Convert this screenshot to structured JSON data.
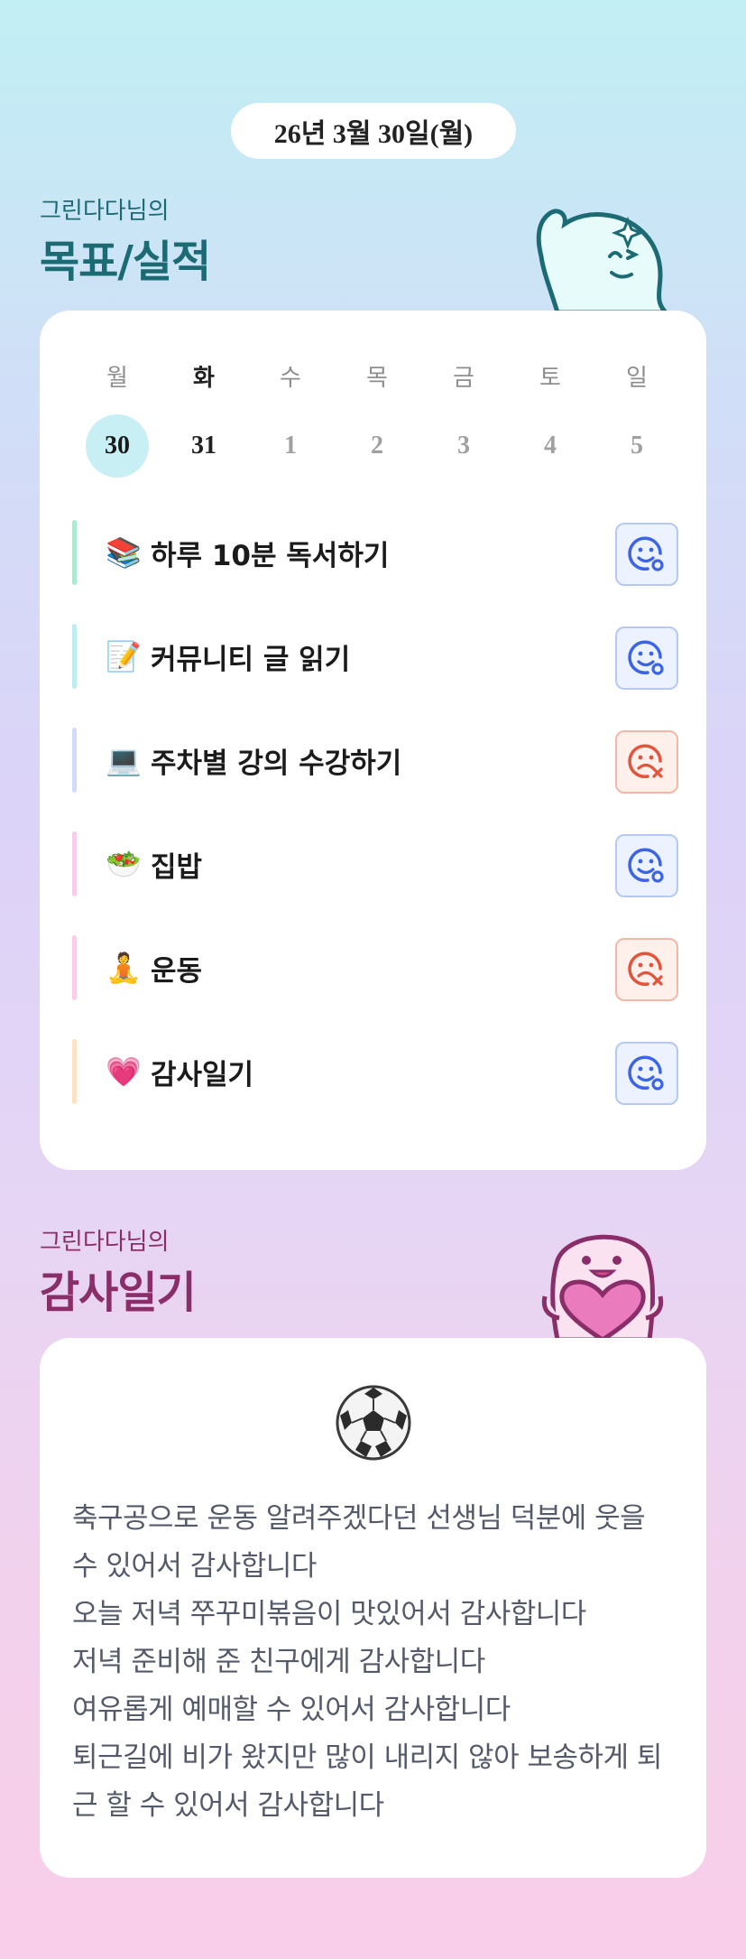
{
  "date": "26년 3월 30일(월)",
  "goals_section": {
    "subtitle": "그린다다님의",
    "title": "목표/실적"
  },
  "week": {
    "days": [
      "월",
      "화",
      "수",
      "목",
      "금",
      "토",
      "일"
    ],
    "dates": [
      "30",
      "31",
      "1",
      "2",
      "3",
      "4",
      "5"
    ],
    "selected_index": 0,
    "today_index": 1
  },
  "goals": [
    {
      "emoji": "📚",
      "label": "하루 10분 독서하기",
      "bar_color": "#aeead2",
      "status": "done"
    },
    {
      "emoji": "📝",
      "label": "커뮤니티 글 읽기",
      "bar_color": "#bfecef",
      "status": "done"
    },
    {
      "emoji": "💻",
      "label": "주차별 강의 수강하기",
      "bar_color": "#d2dcf8",
      "status": "failed"
    },
    {
      "emoji": "🥗",
      "label": "집밥",
      "bar_color": "#f7cde9",
      "status": "done"
    },
    {
      "emoji": "🧘",
      "label": "운동",
      "bar_color": "#fbcde6",
      "status": "failed"
    },
    {
      "emoji": "💗",
      "label": "감사일기",
      "bar_color": "#fde3c4",
      "status": "done"
    }
  ],
  "gratitude_section": {
    "subtitle": "그린다다님의",
    "title": "감사일기"
  },
  "gratitude": {
    "icon": "soccer-ball-icon",
    "text": "축구공으로 운동 알려주겠다던 선생님 덕분에 웃을 수 있어서 감사합니다\n오늘 저녁 쭈꾸미볶음이 맛있어서 감사합니다\n저녁 준비해 준 친구에게 감사합니다\n여유롭게 예매할 수 있어서 감사합니다\n퇴근길에 비가 왔지만 많이 내리지 않아 보송하게 퇴근 할 수 있어서 감사합니다"
  },
  "colors": {
    "teal_title": "#1c6a74",
    "plum_title": "#8a2e6a",
    "done_icon": "#3c64e6",
    "failed_icon": "#e2553c",
    "selected_date_bg": "#c8f0f4"
  }
}
